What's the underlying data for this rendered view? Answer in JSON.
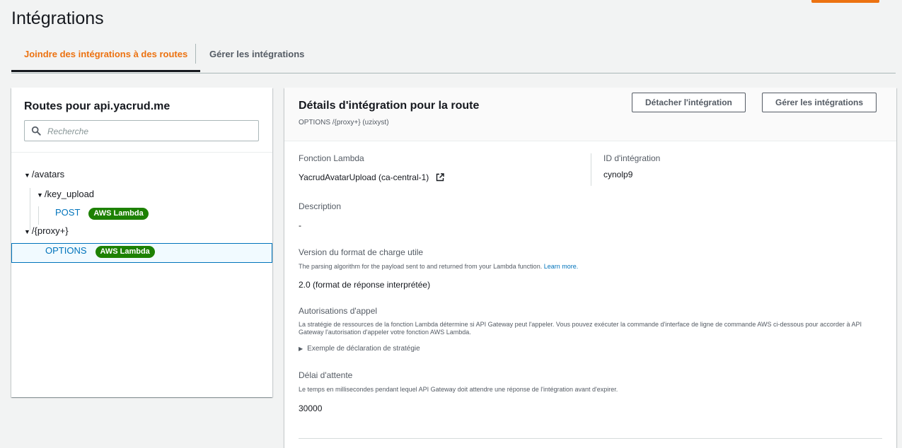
{
  "page": {
    "title": "Intégrations"
  },
  "tabs": {
    "attach": "Joindre des intégrations à des routes",
    "manage": "Gérer les intégrations"
  },
  "routes": {
    "title": "Routes pour api.yacrud.me",
    "search_placeholder": "Recherche",
    "tree": {
      "avatars": "/avatars",
      "key_upload": "/key_upload",
      "post_method": "POST",
      "post_badge": "AWS Lambda",
      "proxy": "/{proxy+}",
      "options_method": "OPTIONS",
      "options_badge": "AWS Lambda"
    }
  },
  "details": {
    "title": "Détails d'intégration pour la route",
    "subtitle": "OPTIONS /{proxy+} (uzixyst)",
    "detach_button": "Détacher l'intégration",
    "manage_button": "Gérer les intégrations",
    "lambda_label": "Fonction Lambda",
    "lambda_value": "YacrudAvatarUpload (ca-central-1)",
    "id_label": "ID d'intégration",
    "id_value": "cynolp9",
    "description_label": "Description",
    "description_value": "-",
    "payload_label": "Version du format de charge utile",
    "payload_desc": "The parsing algorithm for the payload sent to and returned from your Lambda function.",
    "payload_link": "Learn more.",
    "payload_value": "2.0 (format de réponse interprétée)",
    "auth_label": "Autorisations d'appel",
    "auth_desc": "La stratégie de ressources de la fonction Lambda détermine si API Gateway peut l'appeler. Vous pouvez exécuter la commande d'interface de ligne de commande AWS ci-dessous pour accorder à API Gateway l'autorisation d'appeler votre fonction AWS Lambda.",
    "auth_expander": "Exemple de déclaration de stratégie",
    "timeout_label": "Délai d'attente",
    "timeout_desc": "Le temps en millisecondes pendant lequel API Gateway doit attendre une réponse de l'intégration avant d'expirer.",
    "timeout_value": "30000"
  },
  "colors": {
    "accent": "#ec7211",
    "link": "#0073bb",
    "badge": "#1d8102"
  }
}
